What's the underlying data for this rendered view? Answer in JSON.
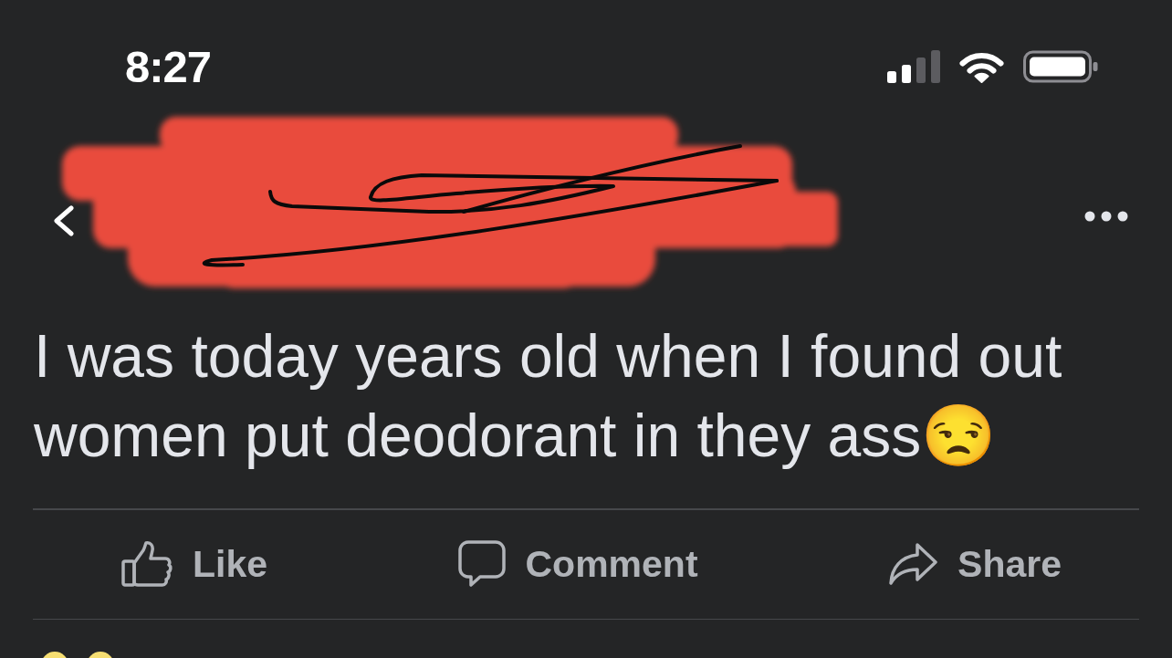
{
  "status_bar": {
    "time": "8:27"
  },
  "post": {
    "text": "I was today years old when I found out women put deodorant in they ass😒"
  },
  "actions": [
    {
      "kind": "like",
      "label": "Like"
    },
    {
      "kind": "comment",
      "label": "Comment"
    },
    {
      "kind": "share",
      "label": "Share"
    }
  ]
}
